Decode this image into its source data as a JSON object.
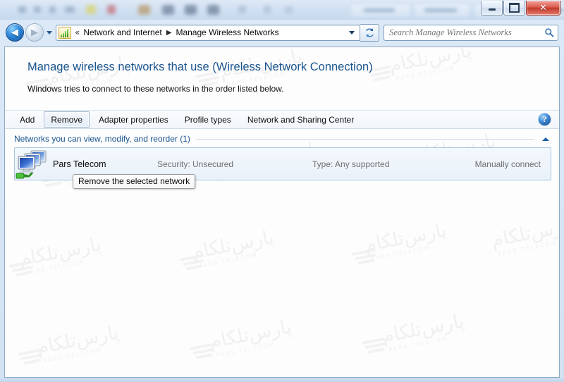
{
  "window": {
    "controls": {
      "minimize_label": "Minimize",
      "maximize_label": "Maximize",
      "close_label": "Close",
      "close_glyph": "✕"
    }
  },
  "addressbar": {
    "back_label": "Back",
    "back_glyph": "◀",
    "forward_label": "Forward",
    "forward_glyph": "▶",
    "history_label": "Recent pages",
    "icon_name": "wireless-signal-icon",
    "overflow_glyph": "«",
    "breadcrumbs": [
      {
        "label": "Network and Internet"
      },
      {
        "label": "Manage Wireless Networks"
      }
    ],
    "separator_glyph": "▶",
    "refresh_label": "Refresh",
    "dropdown_label": "Previous locations"
  },
  "search": {
    "value": "",
    "placeholder": "Search Manage Wireless Networks",
    "icon_name": "search-icon"
  },
  "page": {
    "title": "Manage wireless networks that use (Wireless Network Connection)",
    "subtitle": "Windows tries to connect to these networks in the order listed below."
  },
  "toolbar": {
    "buttons": [
      {
        "label": "Add",
        "state": "normal"
      },
      {
        "label": "Remove",
        "state": "hot"
      },
      {
        "label": "Adapter properties",
        "state": "normal"
      },
      {
        "label": "Profile types",
        "state": "normal"
      },
      {
        "label": "Network and Sharing Center",
        "state": "normal"
      }
    ],
    "help_label": "?",
    "help_name": "help-icon"
  },
  "tooltip": {
    "text": "Remove the selected network",
    "visible": true
  },
  "section": {
    "label": "Networks you can view, modify, and reorder (1)",
    "collapse_label": "Collapse",
    "collapse_icon": "chevron-up-icon"
  },
  "networks": [
    {
      "name": "Pars Telecom",
      "security": "Security: Unsecured",
      "type": "Type: Any supported",
      "connection": "Manually connect",
      "selected": true,
      "icon_name": "network-computers-icon"
    }
  ],
  "watermark": {
    "text_fa": "پارس‌تلکام",
    "text_en": "PARS TELECOM"
  },
  "colors": {
    "accent_blue": "#19548f",
    "link_blue": "#1b5fa8",
    "selection_border": "#a8c6de",
    "frame_blue": "#8faac4",
    "close_red": "#c03a2c",
    "muted_text": "#6f6f6f"
  }
}
